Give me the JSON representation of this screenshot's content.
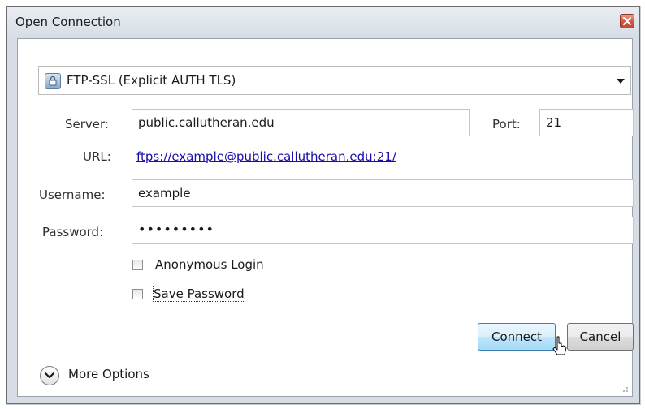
{
  "window": {
    "title": "Open Connection",
    "close_icon": "close-icon"
  },
  "protocol": {
    "selected": "FTP-SSL (Explicit AUTH TLS)",
    "icon": "lock-icon"
  },
  "server": {
    "label": "Server:",
    "value": "public.callutheran.edu"
  },
  "port": {
    "label": "Port:",
    "value": "21"
  },
  "url": {
    "label": "URL:",
    "value": "ftps://example@public.callutheran.edu:21/"
  },
  "username": {
    "label": "Username:",
    "value": "example"
  },
  "password": {
    "label": "Password:",
    "value": "•••••••••"
  },
  "options": {
    "anonymous_label": "Anonymous Login",
    "anonymous_checked": false,
    "save_password_label": "Save Password",
    "save_password_checked": false
  },
  "buttons": {
    "connect": "Connect",
    "cancel": "Cancel"
  },
  "more": {
    "label": "More Options",
    "icon": "chevron-down-circle-icon"
  },
  "colors": {
    "link": "#1a0dab",
    "connect_border": "#3c7fb1",
    "close_red": "#d4553a"
  }
}
